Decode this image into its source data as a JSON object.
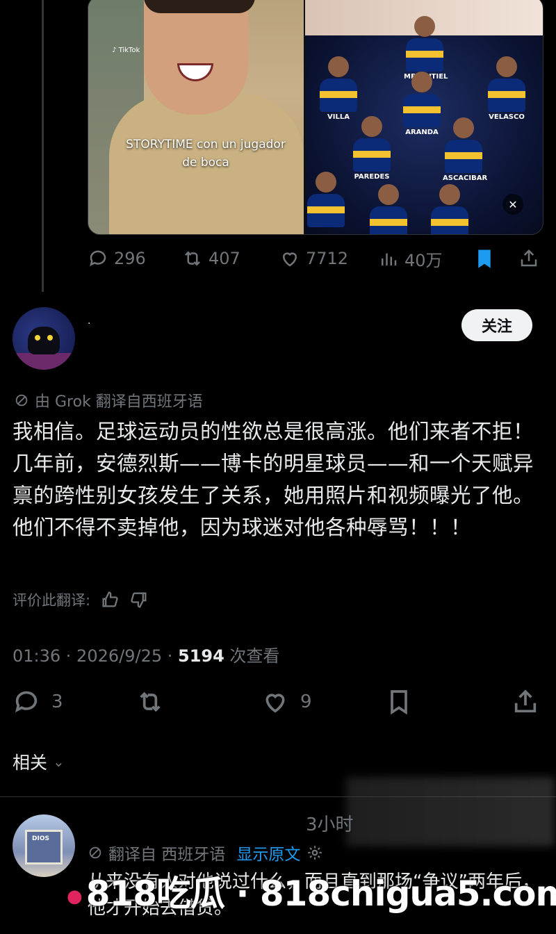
{
  "media": {
    "tiktok_label": "TikTok",
    "caption": "STORYTIME con un jugador de boca",
    "players": [
      "MERENTIEL",
      "VILLA",
      "VELASCO",
      "ARANDA",
      "PAREDES",
      "ASCACIBAR"
    ]
  },
  "post_actions": {
    "replies": "296",
    "reposts": "407",
    "likes": "7712",
    "views": "40万"
  },
  "reply": {
    "author_name": "·",
    "follow_label": "关注",
    "translated_from": "由 Grok 翻译自西班牙语",
    "text": "我相信。足球运动员的性欲总是很高涨。他们来者不拒！几年前，安德烈斯——博卡的明星球员——和一个天赋异禀的跨性别女孩发生了关系，她用照片和视频曝光了他。他们不得不卖掉他，因为球迷对他各种辱骂！！！",
    "rate_label": "评价此翻译:",
    "timestamp": "01:36 · 2026/9/25 · ",
    "view_count": "5194",
    "view_suffix": " 次查看",
    "actions": {
      "replies": "3",
      "likes": "9"
    }
  },
  "related_label": "相关",
  "second_reply": {
    "time": "3小时",
    "translated_from": "翻译自 西班牙语",
    "show_original": "显示原文",
    "text": "从来没有人对他说过什么，而且直到那场“争议”两年后，他才开始去借贷。"
  },
  "watermark": "818吃瓜 · 818chigua5.com",
  "colors": {
    "background": "#000000",
    "text": "#e7e9ea",
    "muted": "#71767b",
    "accent": "#1d9bf0",
    "bookmark": "#1d9bf0"
  }
}
